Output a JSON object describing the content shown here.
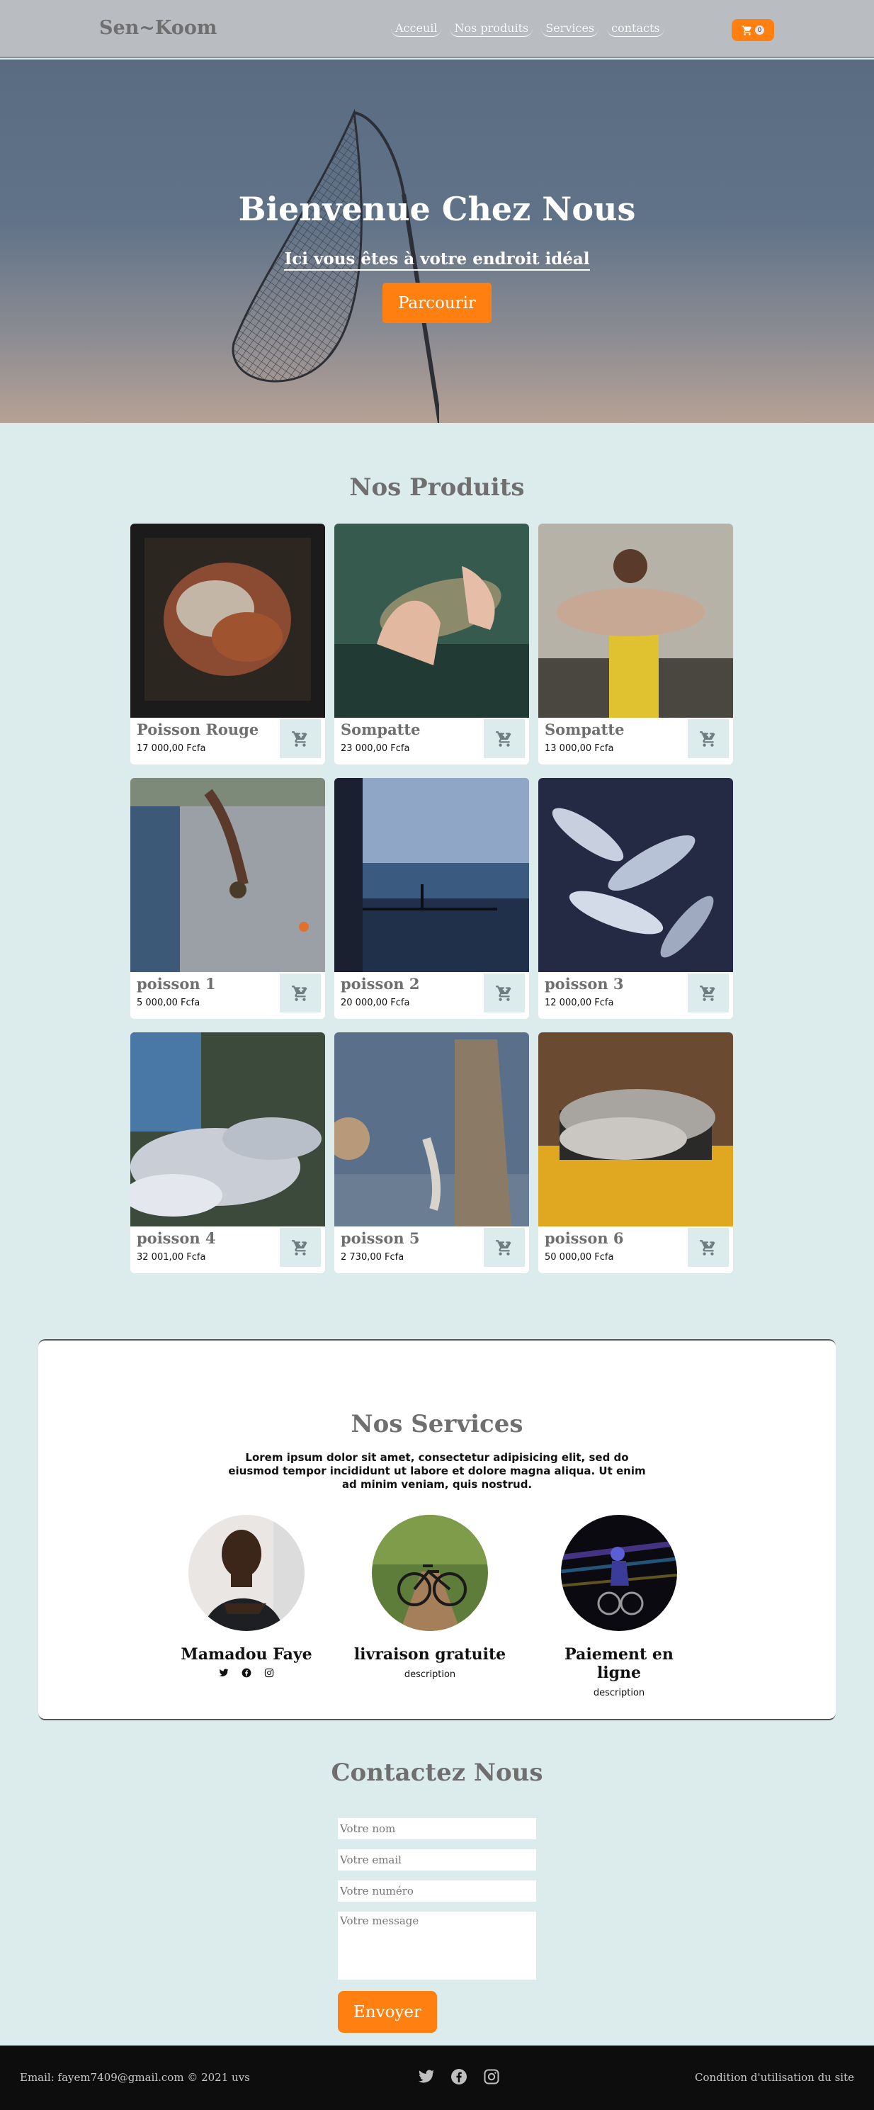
{
  "header": {
    "brand": "Sen~Koom",
    "nav": [
      "Acceuil",
      "Nos produits",
      "Services",
      "contacts"
    ],
    "cart_count": "0",
    "background": "#b9bcc1"
  },
  "hero": {
    "title": "Bienvenue Chez Nous",
    "subtitle": "Ici vous êtes à votre endroit idéal",
    "button": "Parcourir"
  },
  "products": {
    "title": "Nos Produits",
    "items": [
      {
        "name": "Poisson Rouge",
        "price": "17 000,00 Fcfa",
        "cart_icon": "cart-plus-icon"
      },
      {
        "name": "Sompatte",
        "price": "23 000,00 Fcfa",
        "cart_icon": "cart-plus-icon"
      },
      {
        "name": "Sompatte",
        "price": "13 000,00 Fcfa",
        "cart_icon": "cart-plus-icon"
      },
      {
        "name": "poisson 1",
        "price": "5 000,00 Fcfa",
        "cart_icon": "cart-plus-icon"
      },
      {
        "name": "poisson 2",
        "price": "20 000,00 Fcfa",
        "cart_icon": "cart-plus-icon"
      },
      {
        "name": "poisson 3",
        "price": "12 000,00 Fcfa",
        "cart_icon": "cart-plus-icon"
      },
      {
        "name": "poisson 4",
        "price": "32 001,00 Fcfa",
        "cart_icon": "cart-plus-icon"
      },
      {
        "name": "poisson 5",
        "price": "2 730,00 Fcfa",
        "cart_icon": "cart-plus-icon"
      },
      {
        "name": "poisson 6",
        "price": "50 000,00 Fcfa",
        "cart_icon": "cart-plus-icon"
      }
    ]
  },
  "services": {
    "title": "Nos Services",
    "description": "Lorem ipsum dolor sit amet, consectetur adipisicing elit, sed do eiusmod tempor incididunt ut labore et dolore magna aliqua. Ut enim ad minim veniam, quis nostrud.",
    "items": [
      {
        "name": "Mamadou Faye",
        "social": [
          "twitter-icon",
          "facebook-icon",
          "instagram-icon"
        ]
      },
      {
        "name": "livraison gratuite",
        "sub": "description"
      },
      {
        "name": "Paiement en ligne",
        "sub": "description"
      }
    ]
  },
  "contact": {
    "title": "Contactez Nous",
    "name_placeholder": "Votre nom",
    "email_placeholder": "Votre email",
    "phone_placeholder": "Votre numéro",
    "message_placeholder": "Votre message",
    "submit": "Envoyer"
  },
  "footer": {
    "left": "Email: fayem7409@gmail.com © 2021 uvs",
    "right": "Condition d'utilisation du site",
    "social": [
      "twitter-icon",
      "facebook-icon",
      "instagram-icon"
    ]
  },
  "colors": {
    "accent": "#ff7f11",
    "page_bg": "#dcecec",
    "heading": "#6f6f6f"
  }
}
